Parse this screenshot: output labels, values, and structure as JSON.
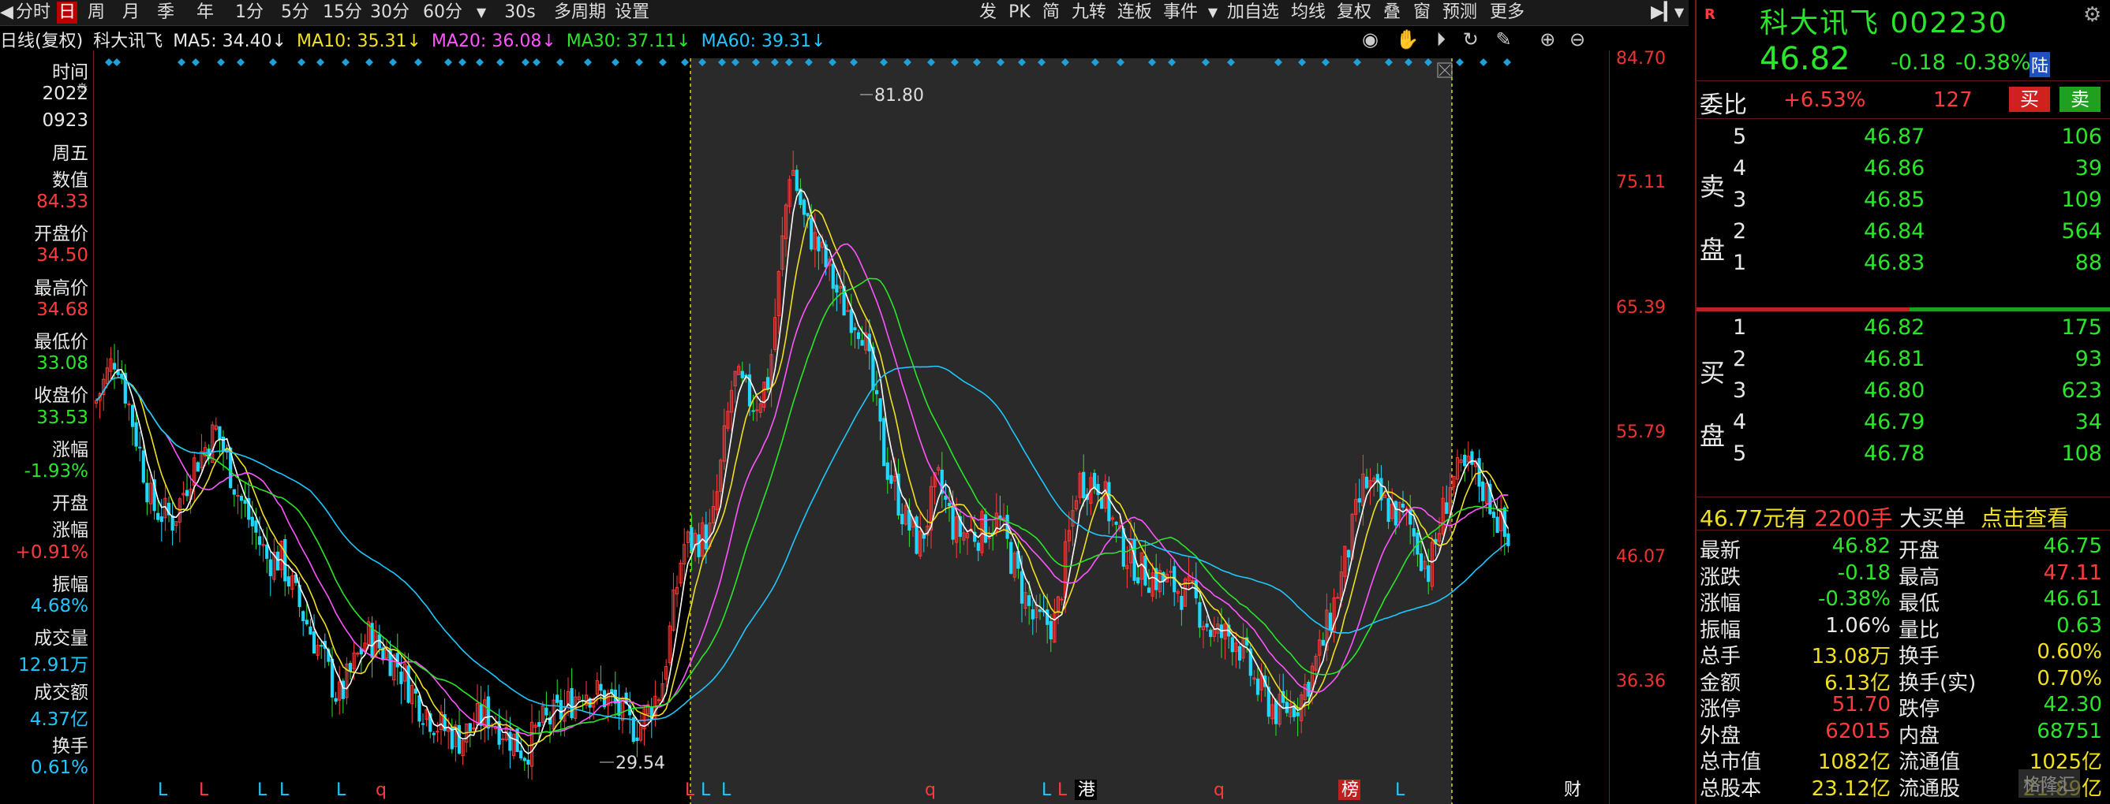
{
  "toolbar": {
    "left_items": [
      "分时",
      "日",
      "周",
      "月",
      "季",
      "年",
      "1分",
      "5分",
      "15分",
      "30分",
      "60分",
      "30s",
      "多周期",
      "设置"
    ],
    "right_items": [
      "发",
      "PK",
      "简",
      "九转",
      "连板",
      "事件",
      "加自选",
      "均线",
      "复权",
      "叠",
      "窗",
      "预测",
      "更多"
    ],
    "active": "日"
  },
  "ma_line": {
    "period": "日线(复权)",
    "stock": "科大讯飞",
    "ma5": "MA5: 34.40↓",
    "ma10": "MA10: 35.31↓",
    "ma20": "MA20: 36.08↓",
    "ma30": "MA30: 37.11↓",
    "ma60": "MA60: 39.31↓"
  },
  "left_panel": {
    "rows": [
      {
        "text": "时间",
        "color": "white"
      },
      {
        "text": "2022",
        "color": "white"
      },
      {
        "text": "0923",
        "color": "white"
      },
      {
        "text": "周五",
        "color": "white"
      },
      {
        "text": "数值",
        "color": "white"
      },
      {
        "text": "84.33",
        "color": "red"
      },
      {
        "text": "开盘价",
        "color": "white"
      },
      {
        "text": "34.50",
        "color": "red"
      },
      {
        "text": "最高价",
        "color": "white"
      },
      {
        "text": "34.68",
        "color": "red"
      },
      {
        "text": "最低价",
        "color": "white"
      },
      {
        "text": "33.08",
        "color": "green"
      },
      {
        "text": "收盘价",
        "color": "white"
      },
      {
        "text": "33.53",
        "color": "green"
      },
      {
        "text": "涨幅",
        "color": "white"
      },
      {
        "text": "-1.93%",
        "color": "green"
      },
      {
        "text": "开盘",
        "color": "white"
      },
      {
        "text": "涨幅",
        "color": "white"
      },
      {
        "text": "+0.91%",
        "color": "red"
      },
      {
        "text": "振幅",
        "color": "white"
      },
      {
        "text": "4.68%",
        "color": "cyan"
      },
      {
        "text": "成交量",
        "color": "white"
      },
      {
        "text": "12.91万",
        "color": "cyan"
      },
      {
        "text": "成交额",
        "color": "white"
      },
      {
        "text": "4.37亿",
        "color": "cyan"
      },
      {
        "text": "换手",
        "color": "white"
      },
      {
        "text": "0.61%",
        "color": "cyan"
      }
    ]
  },
  "y_axis": {
    "ticks": [
      "84.70",
      "75.11",
      "65.39",
      "55.79",
      "46.07",
      "36.36"
    ]
  },
  "chart_annotations": {
    "high": "81.80",
    "low": "29.54"
  },
  "bottom_markers": [
    "L",
    "L",
    "L",
    "L",
    "L",
    "q",
    "L",
    "L",
    "L",
    "q",
    "L",
    "L",
    "港",
    "q",
    "榜",
    "L",
    "财"
  ],
  "right_panel": {
    "r_label": "R",
    "stock_name": "科大讯飞",
    "stock_code": "002230",
    "price": "46.82",
    "change": "-0.18",
    "change_pct": "-0.38%",
    "exchange": "陆",
    "weibi_label": "委比",
    "weibi_value": "+6.53%",
    "weibi_count": "127",
    "buy_btn": "买",
    "sell_btn": "卖",
    "sell_side_label": [
      "卖",
      "盘"
    ],
    "buy_side_label": [
      "买",
      "盘"
    ],
    "sell_orders": [
      {
        "level": "5",
        "price": "46.87",
        "vol": "106"
      },
      {
        "level": "4",
        "price": "46.86",
        "vol": "39"
      },
      {
        "level": "3",
        "price": "46.85",
        "vol": "109"
      },
      {
        "level": "2",
        "price": "46.84",
        "vol": "564"
      },
      {
        "level": "1",
        "price": "46.83",
        "vol": "88"
      }
    ],
    "buy_orders": [
      {
        "level": "1",
        "price": "46.82",
        "vol": "175"
      },
      {
        "level": "2",
        "price": "46.81",
        "vol": "93"
      },
      {
        "level": "3",
        "price": "46.80",
        "vol": "623"
      },
      {
        "level": "4",
        "price": "46.79",
        "vol": "34"
      },
      {
        "level": "5",
        "price": "46.78",
        "vol": "108"
      }
    ],
    "big_order": {
      "price": "46.77元有",
      "vol": "2200手",
      "label": "大买单",
      "link": "点击查看"
    },
    "stats": [
      {
        "l1": "最新",
        "v1": "46.82",
        "c1": "green",
        "l2": "开盘",
        "v2": "46.75",
        "c2": "green"
      },
      {
        "l1": "涨跌",
        "v1": "-0.18",
        "c1": "green",
        "l2": "最高",
        "v2": "47.11",
        "c2": "red"
      },
      {
        "l1": "涨幅",
        "v1": "-0.38%",
        "c1": "green",
        "l2": "最低",
        "v2": "46.61",
        "c2": "green"
      },
      {
        "l1": "振幅",
        "v1": "1.06%",
        "c1": "white",
        "l2": "量比",
        "v2": "0.63",
        "c2": "green"
      },
      {
        "l1": "总手",
        "v1": "13.08万",
        "c1": "yellow",
        "l2": "换手",
        "v2": "0.60%",
        "c2": "yellow"
      },
      {
        "l1": "金额",
        "v1": "6.13亿",
        "c1": "yellow",
        "l2": "换手(实)",
        "v2": "0.70%",
        "c2": "yellow"
      },
      {
        "l1": "涨停",
        "v1": "51.70",
        "c1": "red",
        "l2": "跌停",
        "v2": "42.30",
        "c2": "green"
      },
      {
        "l1": "外盘",
        "v1": "62015",
        "c1": "red",
        "l2": "内盘",
        "v2": "68751",
        "c2": "green"
      },
      {
        "l1": "总市值",
        "v1": "1082亿",
        "c1": "yellow",
        "l2": "流通值",
        "v2": "1025亿",
        "c2": "yellow"
      },
      {
        "l1": "总股本",
        "v1": "23.12亿",
        "c1": "yellow",
        "l2": "流通股",
        "v2": "21.89亿",
        "c2": "yellow"
      }
    ],
    "watermark": "格隆汇"
  },
  "colors": {
    "up": "#ff3b3b",
    "down": "#2be52b",
    "ma5": "#ffffff",
    "ma10": "#f0e020",
    "ma20": "#ff55ff",
    "ma30": "#2be52b",
    "ma60": "#1ec8ff",
    "highlight": "#2a2a2a",
    "marker": "#1ea0d8"
  }
}
